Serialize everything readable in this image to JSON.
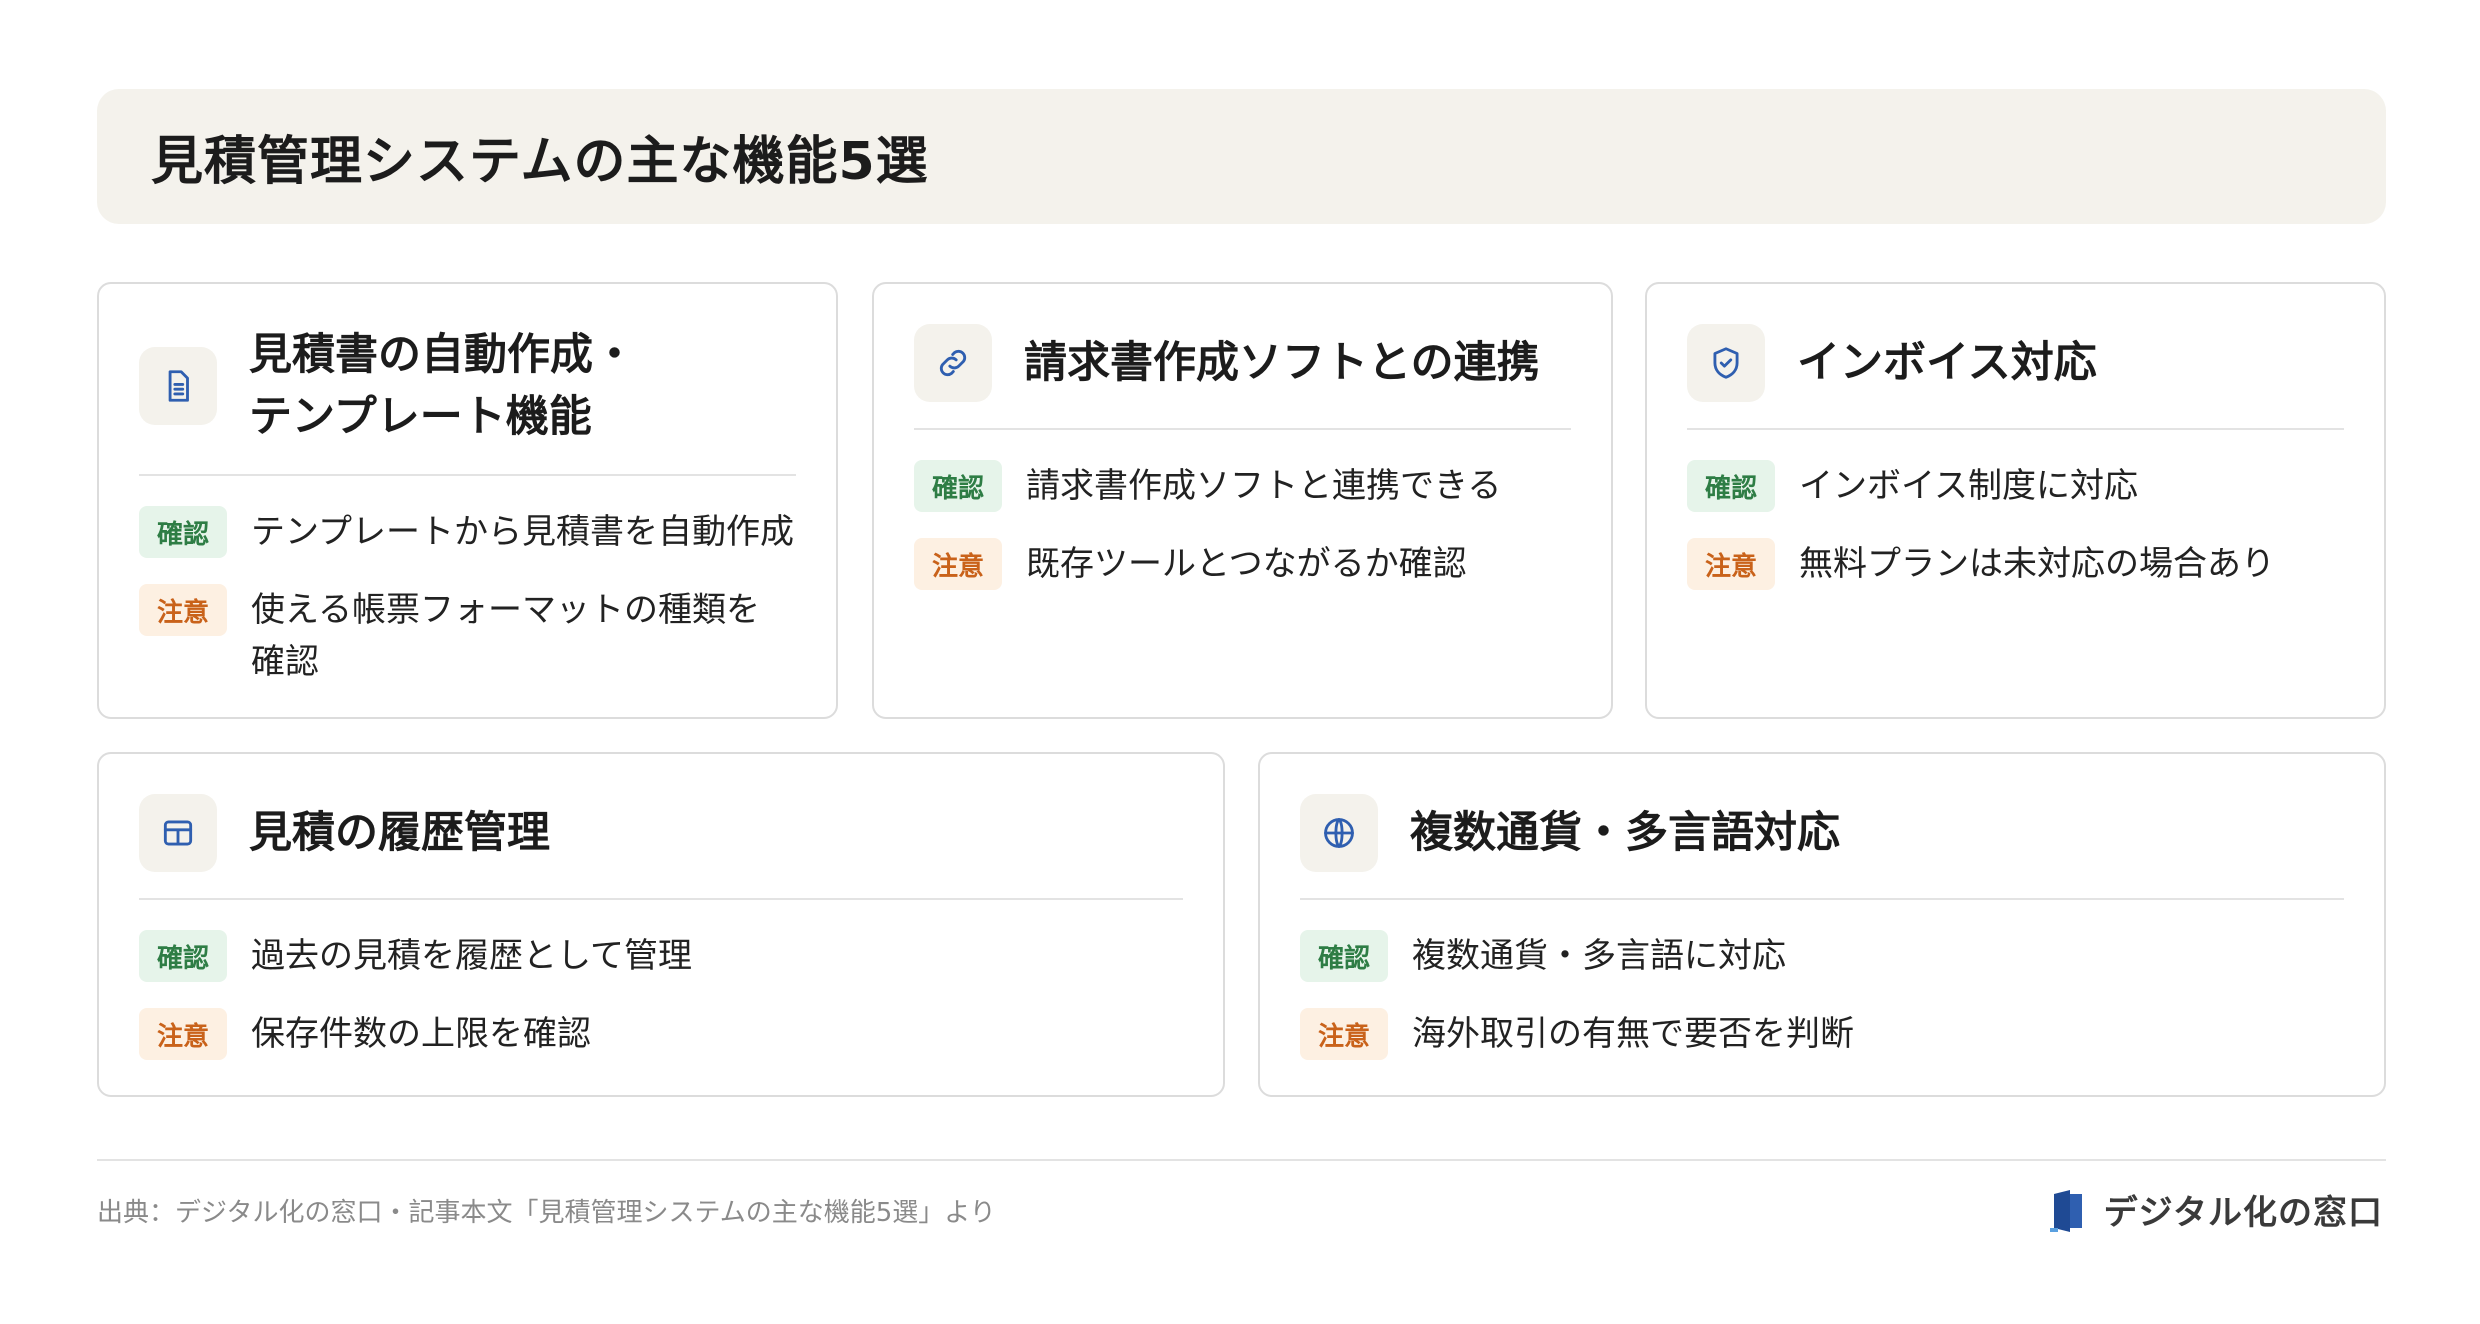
{
  "title": "見積管理システムの主な機能5選",
  "badges": {
    "ok": "確認",
    "warn": "注意"
  },
  "cards": [
    {
      "title": "見積書の自動作成・\nテンプレート機能",
      "icon": "document-icon",
      "ok": "テンプレートから見積書を自動作成",
      "warn": "使える帳票フォーマットの種類を\n確認"
    },
    {
      "title": "請求書作成ソフトとの連携",
      "icon": "link-icon",
      "ok": "請求書作成ソフトと連携できる",
      "warn": "既存ツールとつながるか確認"
    },
    {
      "title": "インボイス対応",
      "icon": "shield-check-icon",
      "ok": "インボイス制度に対応",
      "warn": "無料プランは未対応の場合あり"
    },
    {
      "title": "見積の履歴管理",
      "icon": "table-icon",
      "ok": "過去の見積を履歴として管理",
      "warn": "保存件数の上限を確認"
    },
    {
      "title": "複数通貨・多言語対応",
      "icon": "globe-icon",
      "ok": "複数通貨・多言語に対応",
      "warn": "海外取引の有無で要否を判断"
    }
  ],
  "footer": {
    "source": "出典：デジタル化の窓口・記事本文「見積管理システムの主な機能5選」より",
    "brand": "デジタル化の窓口",
    "brand_icon": "door-logo-icon"
  },
  "colors": {
    "accent": "#2f5fb0",
    "ok_bg": "#e6f4ea",
    "ok_fg": "#2e7d45",
    "warn_bg": "#fdf0e2",
    "warn_fg": "#c9621a",
    "panel": "#f4f2ec"
  }
}
